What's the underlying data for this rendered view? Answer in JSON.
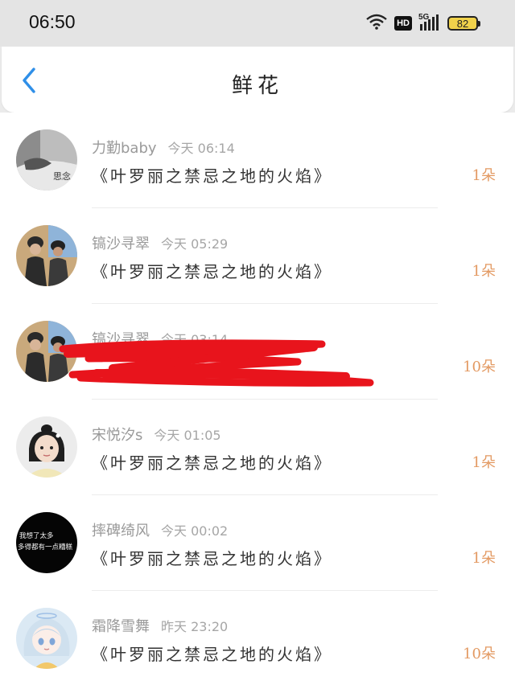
{
  "status_bar": {
    "time": "06:50",
    "hd": "HD",
    "network": "5G",
    "battery": "82"
  },
  "header": {
    "title": "鲜花"
  },
  "records": [
    {
      "name": "力勤baby",
      "time": "今天 06:14",
      "gift": "《叶罗丽之禁忌之地的火焰》",
      "count": "1朵"
    },
    {
      "name": "镐沙寻翠",
      "time": "今天 05:29",
      "gift": "《叶罗丽之禁忌之地的火焰》",
      "count": "1朵"
    },
    {
      "name": "镐沙寻翠",
      "time": "今天 03:14",
      "gift": "",
      "count": "10朵"
    },
    {
      "name": "宋悦汐s",
      "time": "今天 01:05",
      "gift": "《叶罗丽之禁忌之地的火焰》",
      "count": "1朵"
    },
    {
      "name": "摔碑绮风",
      "time": "今天 00:02",
      "gift": "《叶罗丽之禁忌之地的火焰》",
      "count": "1朵"
    },
    {
      "name": "霜降雪舞",
      "time": "昨天 23:20",
      "gift": "《叶罗丽之禁忌之地的火焰》",
      "count": "10朵"
    }
  ],
  "avatar_texts": {
    "avatar1": "思念",
    "avatar5_line1": "我想了太多",
    "avatar5_line2": "多得都有一点糟糕"
  },
  "colors": {
    "accent_blue": "#2f8fe8",
    "count_orange": "#e39a63",
    "redaction_red": "#e8141c"
  }
}
